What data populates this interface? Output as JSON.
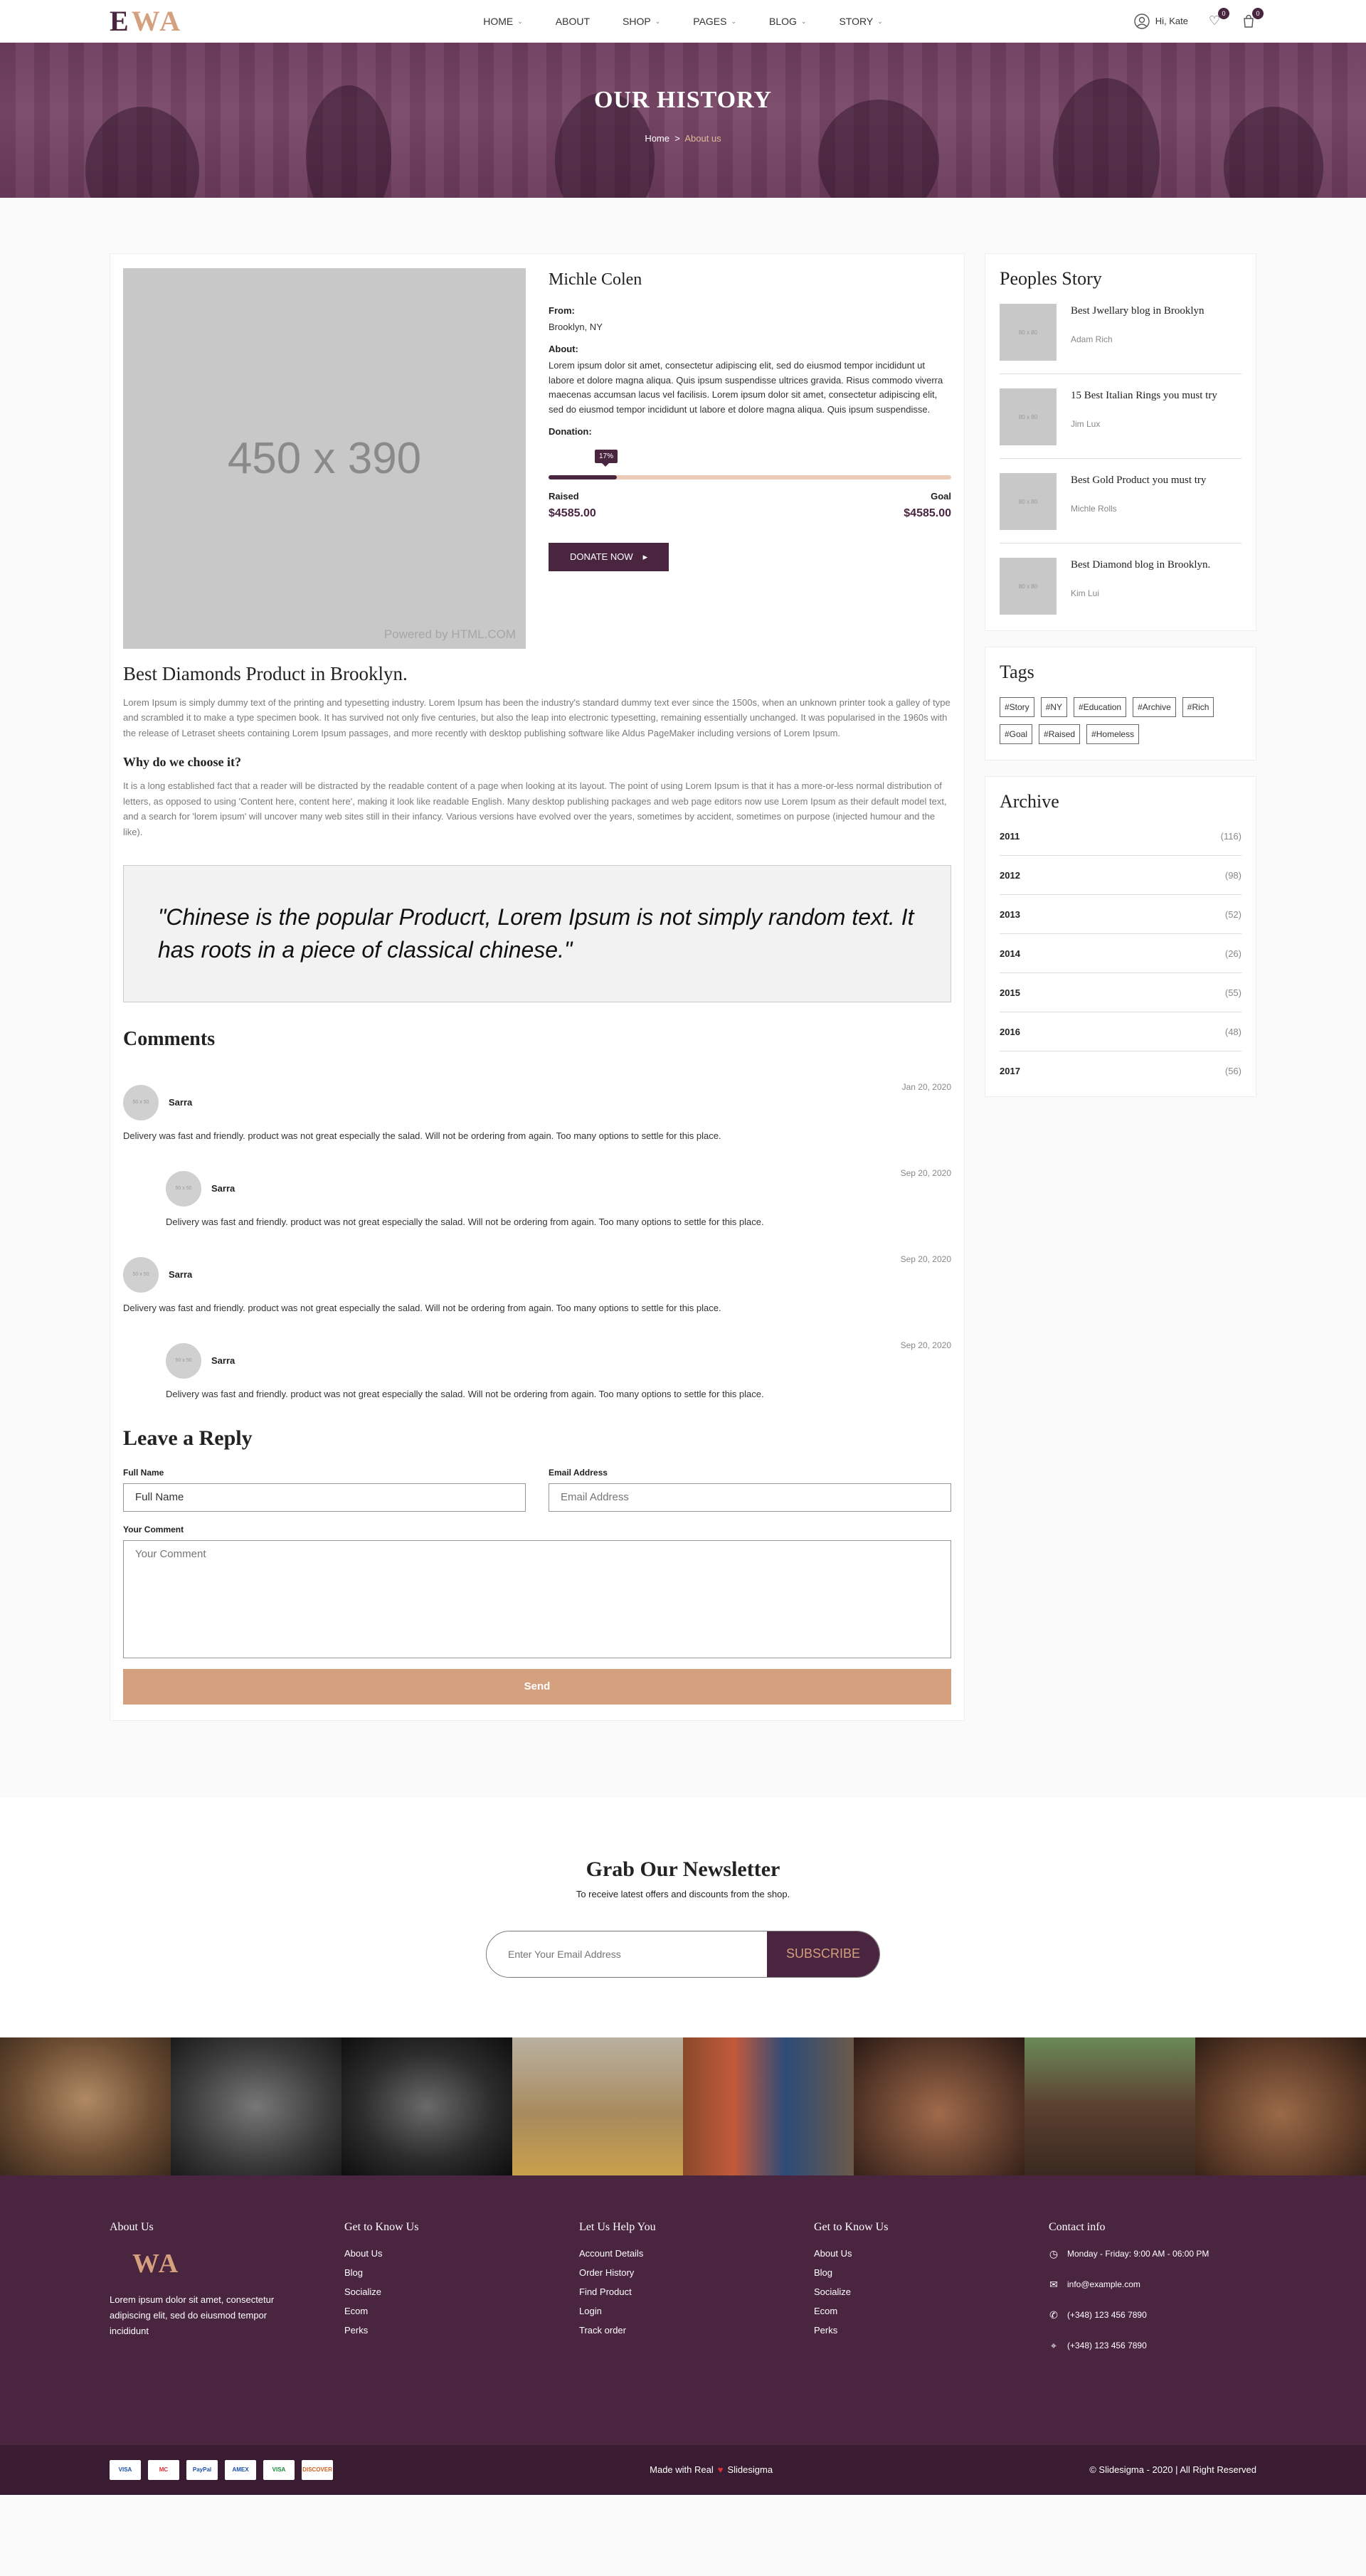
{
  "header": {
    "logo_e": "E",
    "logo_wa": "WA",
    "menu": [
      {
        "label": "HOME",
        "caret": true
      },
      {
        "label": "ABOUT",
        "caret": false
      },
      {
        "label": "SHOP",
        "caret": true
      },
      {
        "label": "PAGES",
        "caret": true
      },
      {
        "label": "BLOG",
        "caret": true
      },
      {
        "label": "STORY",
        "caret": true
      }
    ],
    "greeting": "Hi, Kate",
    "wishlist_count": "0",
    "cart_count": "0"
  },
  "hero": {
    "title": "OUR HISTORY",
    "crumb_home": "Home",
    "crumb_sep": ">",
    "crumb_current": "About us"
  },
  "story": {
    "image_label": "450 x 390",
    "image_credit": "Powered by HTML.COM",
    "name": "Michle Colen",
    "from_label": "From:",
    "from_value": "Brooklyn, NY",
    "about_label": "About:",
    "about_text": "Lorem ipsum dolor sit amet, consectetur adipiscing elit, sed do eiusmod tempor incididunt ut labore et dolore magna aliqua. Quis ipsum suspendisse ultrices gravida. Risus commodo viverra maecenas accumsan lacus vel facilisis. Lorem ipsum dolor sit amet, consectetur adipiscing elit, sed do eiusmod tempor incididunt ut labore et dolore magna aliqua. Quis ipsum suspendisse.",
    "donation_label": "Donation:",
    "progress_percent": 17,
    "progress_label": "17%",
    "raised_label": "Raised",
    "raised_value": "$4585.00",
    "goal_label": "Goal",
    "goal_value": "$4585.00",
    "donate_button": "DONATE NOW",
    "donate_arrow": "▸"
  },
  "article": {
    "title": "Best Diamonds Product in Brooklyn.",
    "paragraph1": "Lorem Ipsum is simply dummy text of the printing and typesetting industry. Lorem Ipsum has been the industry's standard dummy text ever since the 1500s, when an unknown printer took a galley of type and scrambled it to make a type specimen book. It has survived not only five centuries, but also the leap into electronic typesetting, remaining essentially unchanged. It was popularised in the 1960s with the release of Letraset sheets containing Lorem Ipsum passages, and more recently with desktop publishing software like Aldus PageMaker including versions of Lorem Ipsum.",
    "subtitle": "Why do we choose it?",
    "paragraph2": "It is a long established fact that a reader will be distracted by the readable content of a page when looking at its layout. The point of using Lorem Ipsum is that it has a more-or-less normal distribution of letters, as opposed to using 'Content here, content here', making it look like readable English. Many desktop publishing packages and web page editors now use Lorem Ipsum as their default model text, and a search for 'lorem ipsum' will uncover many web sites still in their infancy. Various versions have evolved over the years, sometimes by accident, sometimes on purpose (injected humour and the like).",
    "quote": "\"Chinese is the popular Producrt, Lorem Ipsum is not simply random text. It has roots in a piece of classical chinese.\""
  },
  "comments": {
    "title": "Comments",
    "avatar_label": "50 x 50",
    "items": [
      {
        "name": "Sarra",
        "date": "Jan 20, 2020",
        "text": "Delivery was fast and friendly. product was not great especially the salad. Will not be ordering from again. Too many options to settle for this place.",
        "reply": false
      },
      {
        "name": "Sarra",
        "date": "Sep 20, 2020",
        "text": "Delivery was fast and friendly. product was not great especially the salad. Will not be ordering from again. Too many options to settle for this place.",
        "reply": true
      },
      {
        "name": "Sarra",
        "date": "Sep 20, 2020",
        "text": "Delivery was fast and friendly. product was not great especially the salad. Will not be ordering from again. Too many options to settle for this place.",
        "reply": false
      },
      {
        "name": "Sarra",
        "date": "Sep 20, 2020",
        "text": "Delivery was fast and friendly. product was not great especially the salad. Will not be ordering from again. Too many options to settle for this place.",
        "reply": true
      }
    ]
  },
  "reply_form": {
    "title": "Leave a Reply",
    "name_label": "Full Name",
    "name_value": "Full Name",
    "email_label": "Email Address",
    "email_placeholder": "Email Address",
    "comment_label": "Your Comment",
    "comment_placeholder": "Your Comment",
    "send_button": "Send"
  },
  "sidebar": {
    "peoples_title": "Peoples Story",
    "thumb_label": "80 x 80",
    "stories": [
      {
        "title": "Best Jwellary blog in Brooklyn",
        "author": "Adam Rich"
      },
      {
        "title": "15 Best Italian Rings you must try",
        "author": "Jim Lux"
      },
      {
        "title": "Best Gold Product you must try",
        "author": "Michle Rolls"
      },
      {
        "title": "Best Diamond blog in Brooklyn.",
        "author": "Kim Lui"
      }
    ],
    "tags_title": "Tags",
    "tags": [
      "#Story",
      "#NY",
      "#Education",
      "#Archive",
      "#Rich",
      "#Goal",
      "#Raised",
      "#Homeless"
    ],
    "archive_title": "Archive",
    "archive": [
      {
        "year": "2011",
        "count": "(116)"
      },
      {
        "year": "2012",
        "count": "(98)"
      },
      {
        "year": "2013",
        "count": "(52)"
      },
      {
        "year": "2014",
        "count": "(26)"
      },
      {
        "year": "2015",
        "count": "(55)"
      },
      {
        "year": "2016",
        "count": "(48)"
      },
      {
        "year": "2017",
        "count": "(56)"
      }
    ]
  },
  "newsletter": {
    "title": "Grab Our Newsletter",
    "subtitle": "To receive latest offers and discounts from the shop.",
    "placeholder": "Enter Your Email Address",
    "button": "SUBSCRIBE"
  },
  "footer": {
    "about_title": "About Us",
    "logo": "WA",
    "about_text": "Lorem ipsum dolor sit amet, consectetur adipiscing elit, sed do eiusmod tempor incididunt",
    "col2_title": "Get to Know Us",
    "col2_links": [
      "About Us",
      "Blog",
      "Socialize",
      "Ecom",
      "Perks"
    ],
    "col3_title": "Let Us Help You",
    "col3_links": [
      "Account Details",
      "Order History",
      "Find Product",
      "Login",
      "Track order"
    ],
    "col4_title": "Get to Know Us",
    "col4_links": [
      "About Us",
      "Blog",
      "Socialize",
      "Ecom",
      "Perks"
    ],
    "contact_title": "Contact info",
    "hours": "Monday - Friday: 9:00 AM - 06:00 PM",
    "email": "info@example.com",
    "phone1": "(+348) 123 456 7890",
    "phone2": "(+348) 123 456 7890",
    "cards": [
      "VISA",
      "MC",
      "PayPal",
      "AMEX",
      "VISA",
      "DISCOVER"
    ],
    "made_with": "Made with Real",
    "heart": "♥",
    "made_by": "Slidesigma",
    "copyright": "© Slidesigma - 2020 | All Right Reserved"
  },
  "colors": {
    "brand_dark": "#4a2540",
    "brand_accent": "#d4a07e"
  }
}
